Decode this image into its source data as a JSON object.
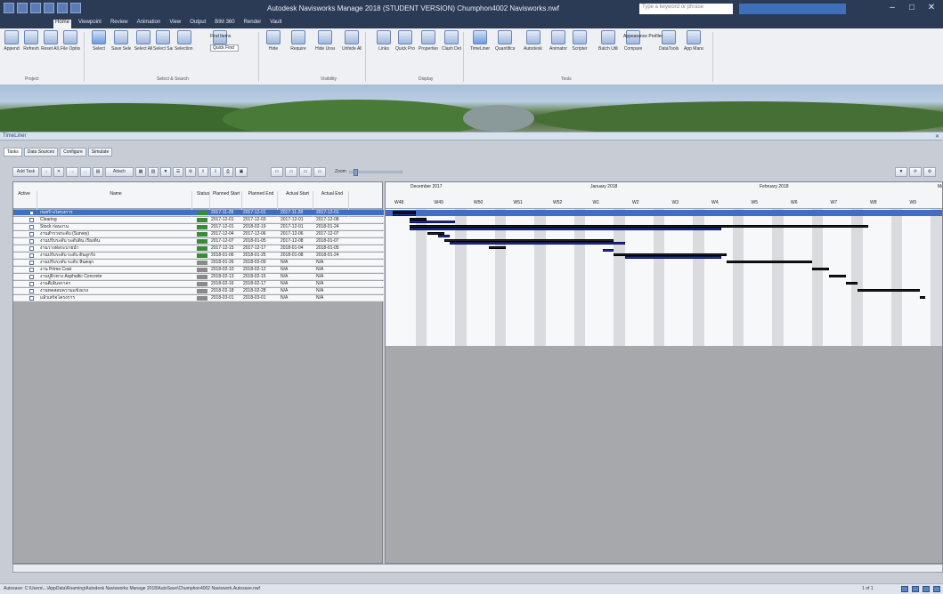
{
  "app": {
    "title": "Autodesk Navisworks Manage 2018 (STUDENT VERSION)   Chumphon4002 Navisworks.nwf",
    "search_placeholder": "Type a keyword or phrase",
    "user_area": ""
  },
  "menu_tabs": [
    "Home",
    "Viewpoint",
    "Review",
    "Animation",
    "View",
    "Output",
    "BIM 360",
    "Render",
    "Vault"
  ],
  "ribbon": {
    "buttons": [
      "Append",
      "Refresh",
      "Reset All...",
      "File Options",
      "Select",
      "Save Selection",
      "Select All",
      "Select Same",
      "Selection Tree",
      "Sets",
      "Hide",
      "Require",
      "Hide Unselected",
      "Unhide All",
      "Links",
      "Quick Properties",
      "Properties",
      "Clash Detective",
      "TimeLiner",
      "Quantification",
      "Autodesk Rendering",
      "Animator",
      "Scripter",
      "Batch Utility",
      "Compare",
      "DataTools",
      "App Manager"
    ],
    "find_items": "Find Items",
    "quick_find": "Quick Find",
    "appearance_profiler": "Appearance Profiler",
    "panels": [
      "Project",
      "Select & Search",
      "Visibility",
      "Display",
      "Tools"
    ]
  },
  "timeliner": {
    "title": "TimeLiner",
    "tabs": [
      "Tasks",
      "Data Sources",
      "Configure",
      "Simulate"
    ],
    "toolbar": {
      "add_task": "Add Task",
      "attach": "Attach",
      "zoom": "Zoom"
    },
    "columns": [
      "Active",
      "Name",
      "Status",
      "Planned Start",
      "Planned End",
      "Actual Start",
      "Actual End"
    ],
    "tasks": [
      {
        "name": "ก่อสร้างโครงการ",
        "planned_start": "2017-11-28",
        "planned_end": "2017-12-01",
        "actual_start": "2017-11-28",
        "actual_end": "2017-12-01"
      },
      {
        "name": "Clearing",
        "planned_start": "2017-12-01",
        "planned_end": "2017-12-03",
        "actual_start": "2017-12-01",
        "actual_end": "2017-12-08"
      },
      {
        "name": "Stock ก่อนงาน",
        "planned_start": "2017-12-01",
        "planned_end": "2018-02-19",
        "actual_start": "2017-12-01",
        "actual_end": "2018-01-24"
      },
      {
        "name": "งานสำรวจระดับ (Survey)",
        "planned_start": "2017-12-04",
        "planned_end": "2017-12-06",
        "actual_start": "2017-12-06",
        "actual_end": "2017-12-07"
      },
      {
        "name": "งานปรับระดับ ระดับดิน เรียงดิน",
        "planned_start": "2017-12-07",
        "planned_end": "2018-01-05",
        "actual_start": "2017-12-08",
        "actual_end": "2018-01-07"
      },
      {
        "name": "งานวางท่อระบายน้ำ",
        "planned_start": "2017-12-15",
        "planned_end": "2017-12-17",
        "actual_start": "2018-01-04",
        "actual_end": "2018-01-05"
      },
      {
        "name": "งานปรับระดับ ระดับ ดินลูกรัง",
        "planned_start": "2018-01-06",
        "planned_end": "2018-01-25",
        "actual_start": "2018-01-08",
        "actual_end": "2018-01-24"
      },
      {
        "name": "งานปรับระดับ ระดับ หินคลุก",
        "planned_start": "2018-01-26",
        "planned_end": "2018-02-09",
        "actual_start": "N/A",
        "actual_end": "N/A"
      },
      {
        "name": "งาน Prime Coat",
        "planned_start": "2018-02-10",
        "planned_end": "2018-02-12",
        "actual_start": "N/A",
        "actual_end": "N/A"
      },
      {
        "name": "งานปูผิวทาง Asphaltic Concrete",
        "planned_start": "2018-02-13",
        "planned_end": "2018-02-15",
        "actual_start": "N/A",
        "actual_end": "N/A"
      },
      {
        "name": "งานตีเส้นจราจร",
        "planned_start": "2018-02-16",
        "planned_end": "2018-02-17",
        "actual_start": "N/A",
        "actual_end": "N/A"
      },
      {
        "name": "งานทดสอบความแข็งแรง",
        "planned_start": "2018-02-18",
        "planned_end": "2018-02-28",
        "actual_start": "N/A",
        "actual_end": "N/A"
      },
      {
        "name": "แล้วเสร็จโครงการ",
        "planned_start": "2018-03-01",
        "planned_end": "2018-03-01",
        "actual_start": "N/A",
        "actual_end": "N/A"
      }
    ],
    "gantt": {
      "months": [
        "December 2017",
        "January 2018",
        "February 2018",
        "Marc"
      ],
      "weeks": [
        "W48",
        "W49",
        "W50",
        "W51",
        "W52",
        "W1",
        "W2",
        "W3",
        "W4",
        "W5",
        "W6",
        "W7",
        "W8",
        "W9"
      ]
    }
  },
  "status": {
    "path": "Autosave: C:\\Users\\...\\AppData\\Roaming\\Autodesk Navisworks Manage 2018\\AutoSave\\Chumphon4002 Naviswork.Autosave.nwf",
    "page": "1 of 1"
  },
  "colors": {
    "accent": "#3f6fc2",
    "bar": "#2233aa",
    "titlebar": "#2b3a55"
  }
}
